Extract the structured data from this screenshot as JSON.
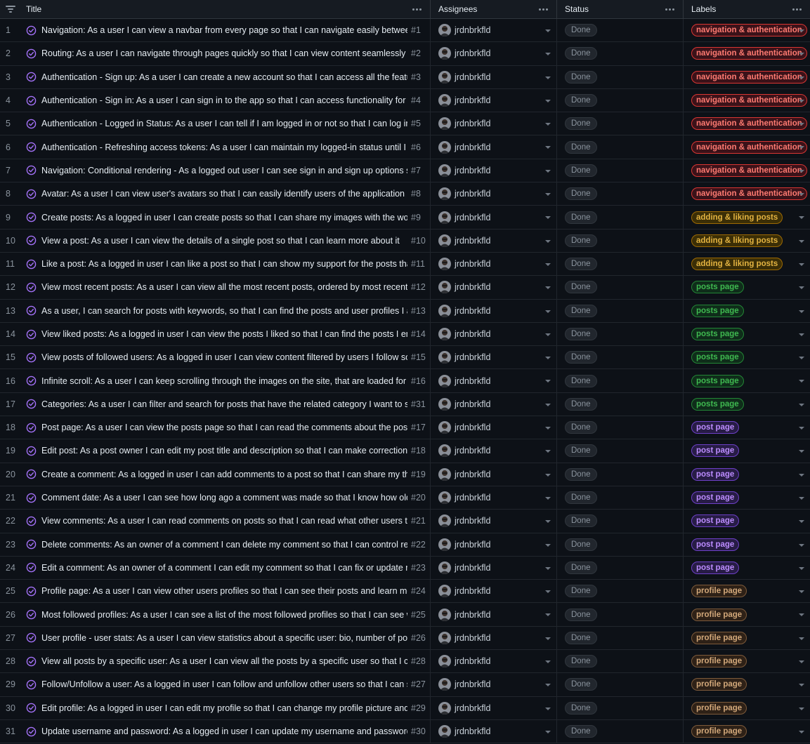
{
  "header": {
    "title": "Title",
    "assignees": "Assignees",
    "status": "Status",
    "labels": "Labels"
  },
  "icons": {
    "filter": "filter-icon",
    "more": "more-options-icon",
    "done": "circle-check-icon",
    "dropdown": "chevron-down-icon"
  },
  "label_styles": {
    "navigation & authentication": {
      "color": "#ff7b72",
      "bg": "#3b1219",
      "border": "#da3633"
    },
    "adding & liking posts": {
      "color": "#e3b341",
      "bg": "#3b2e06",
      "border": "#9e6a03"
    },
    "posts page": {
      "color": "#3fb950",
      "bg": "#0f2d1a",
      "border": "#238636"
    },
    "post page": {
      "color": "#bc8cff",
      "bg": "#271c45",
      "border": "#6e40c9"
    },
    "profile page": {
      "color": "#d2a87a",
      "bg": "#2e2117",
      "border": "#7d5a3a"
    }
  },
  "rows": [
    {
      "n": "1",
      "title": "Navigation: As a user I can view a navbar from every page so that I can navigate easily between pages",
      "issue": "#1",
      "assignee": "jrdnbrkfld",
      "status": "Done",
      "label": "navigation & authentication"
    },
    {
      "n": "2",
      "title": "Routing: As a user I can navigate through pages quickly so that I can view content seamlessly without page refresh",
      "issue": "#2",
      "assignee": "jrdnbrkfld",
      "status": "Done",
      "label": "navigation & authentication"
    },
    {
      "n": "3",
      "title": "Authentication - Sign up: As a user I can create a new account so that I can access all the features for signed up users",
      "issue": "#3",
      "assignee": "jrdnbrkfld",
      "status": "Done",
      "label": "navigation & authentication"
    },
    {
      "n": "4",
      "title": "Authentication - Sign in: As a user I can sign in to the app so that I can access functionality for logged in users",
      "issue": "#4",
      "assignee": "jrdnbrkfld",
      "status": "Done",
      "label": "navigation & authentication"
    },
    {
      "n": "5",
      "title": "Authentication - Logged in Status: As a user I can tell if I am logged in or not so that I can log in if I need to",
      "issue": "#5",
      "assignee": "jrdnbrkfld",
      "status": "Done",
      "label": "navigation & authentication"
    },
    {
      "n": "6",
      "title": "Authentication - Refreshing access tokens: As a user I can maintain my logged-in status until I choose to log out",
      "issue": "#6",
      "assignee": "jrdnbrkfld",
      "status": "Done",
      "label": "navigation & authentication"
    },
    {
      "n": "7",
      "title": "Navigation: Conditional rendering - As a logged out user I can see sign in and sign up options so that I can sign in/sign up",
      "issue": "#7",
      "assignee": "jrdnbrkfld",
      "status": "Done",
      "label": "navigation & authentication"
    },
    {
      "n": "8",
      "title": "Avatar: As a user I can view user's avatars so that I can easily identify users of the application",
      "issue": "#8",
      "assignee": "jrdnbrkfld",
      "status": "Done",
      "label": "navigation & authentication"
    },
    {
      "n": "9",
      "title": "Create posts: As a logged in user I can create posts so that I can share my images with the world",
      "issue": "#9",
      "assignee": "jrdnbrkfld",
      "status": "Done",
      "label": "adding & liking posts"
    },
    {
      "n": "10",
      "title": "View a post: As a user I can view the details of a single post so that I can learn more about it",
      "issue": "#10",
      "assignee": "jrdnbrkfld",
      "status": "Done",
      "label": "adding & liking posts"
    },
    {
      "n": "11",
      "title": "Like a post: As a logged in user I can like a post so that I can show my support for the posts that interest me",
      "issue": "#11",
      "assignee": "jrdnbrkfld",
      "status": "Done",
      "label": "adding & liking posts"
    },
    {
      "n": "12",
      "title": "View most recent posts: As a user I can view all the most recent posts, ordered by most recently created first",
      "issue": "#12",
      "assignee": "jrdnbrkfld",
      "status": "Done",
      "label": "posts page"
    },
    {
      "n": "13",
      "title": "As a user, I can search for posts with keywords, so that I can find the posts and user profiles I am most interested in",
      "issue": "#13",
      "assignee": "jrdnbrkfld",
      "status": "Done",
      "label": "posts page"
    },
    {
      "n": "14",
      "title": "View liked posts: As a logged in user I can view the posts I liked so that I can find the posts I enjoy the most",
      "issue": "#14",
      "assignee": "jrdnbrkfld",
      "status": "Done",
      "label": "posts page"
    },
    {
      "n": "15",
      "title": "View posts of followed users: As a logged in user I can view content filtered by users I follow so that I can keep up",
      "issue": "#15",
      "assignee": "jrdnbrkfld",
      "status": "Done",
      "label": "posts page"
    },
    {
      "n": "16",
      "title": "Infinite scroll: As a user I can keep scrolling through the images on the site, that are loaded for me automatically",
      "issue": "#16",
      "assignee": "jrdnbrkfld",
      "status": "Done",
      "label": "posts page"
    },
    {
      "n": "17",
      "title": "Categories: As a user I can filter and search for posts that have the related category I want to see",
      "issue": "#31",
      "assignee": "jrdnbrkfld",
      "status": "Done",
      "label": "posts page"
    },
    {
      "n": "18",
      "title": "Post page: As a user I can view the posts page so that I can read the comments about the post",
      "issue": "#17",
      "assignee": "jrdnbrkfld",
      "status": "Done",
      "label": "post page"
    },
    {
      "n": "19",
      "title": "Edit post: As a post owner I can edit my post title and description so that I can make corrections or update my post",
      "issue": "#18",
      "assignee": "jrdnbrkfld",
      "status": "Done",
      "label": "post page"
    },
    {
      "n": "20",
      "title": "Create a comment: As a logged in user I can add comments to a post so that I can share my thoughts about the post",
      "issue": "#19",
      "assignee": "jrdnbrkfld",
      "status": "Done",
      "label": "post page"
    },
    {
      "n": "21",
      "title": "Comment date: As a user I can see how long ago a comment was made so that I know how old a comment is",
      "issue": "#20",
      "assignee": "jrdnbrkfld",
      "status": "Done",
      "label": "post page"
    },
    {
      "n": "22",
      "title": "View comments: As a user I can read comments on posts so that I can read what other users think about the posts",
      "issue": "#21",
      "assignee": "jrdnbrkfld",
      "status": "Done",
      "label": "post page"
    },
    {
      "n": "23",
      "title": "Delete comments: As an owner of a comment I can delete my comment so that I can control removal of my comment",
      "issue": "#22",
      "assignee": "jrdnbrkfld",
      "status": "Done",
      "label": "post page"
    },
    {
      "n": "24",
      "title": "Edit a comment: As an owner of a comment I can edit my comment so that I can fix or update my existing comment",
      "issue": "#23",
      "assignee": "jrdnbrkfld",
      "status": "Done",
      "label": "post page"
    },
    {
      "n": "25",
      "title": "Profile page: As a user I can view other users profiles so that I can see their posts and learn more about them",
      "issue": "#24",
      "assignee": "jrdnbrkfld",
      "status": "Done",
      "label": "profile page"
    },
    {
      "n": "26",
      "title": "Most followed profiles: As a user I can see a list of the most followed profiles so that I can see which profiles are popular",
      "issue": "#25",
      "assignee": "jrdnbrkfld",
      "status": "Done",
      "label": "profile page"
    },
    {
      "n": "27",
      "title": "User profile - user stats: As a user I can view statistics about a specific user: bio, number of posts, follows and users followed",
      "issue": "#26",
      "assignee": "jrdnbrkfld",
      "status": "Done",
      "label": "profile page"
    },
    {
      "n": "28",
      "title": "View all posts by a specific user: As a user I can view all the posts by a specific user so that I can catch up on their latest posts",
      "issue": "#28",
      "assignee": "jrdnbrkfld",
      "status": "Done",
      "label": "profile page"
    },
    {
      "n": "29",
      "title": "Follow/Unfollow a user: As a logged in user I can follow and unfollow other users so that I can see and remove posts",
      "issue": "#27",
      "assignee": "jrdnbrkfld",
      "status": "Done",
      "label": "profile page"
    },
    {
      "n": "30",
      "title": "Edit profile: As a logged in user I can edit my profile so that I can change my profile picture and bio",
      "issue": "#29",
      "assignee": "jrdnbrkfld",
      "status": "Done",
      "label": "profile page"
    },
    {
      "n": "31",
      "title": "Update username and password: As a logged in user I can update my username and password so that I can keep my profile secure",
      "issue": "#30",
      "assignee": "jrdnbrkfld",
      "status": "Done",
      "label": "profile page"
    }
  ]
}
